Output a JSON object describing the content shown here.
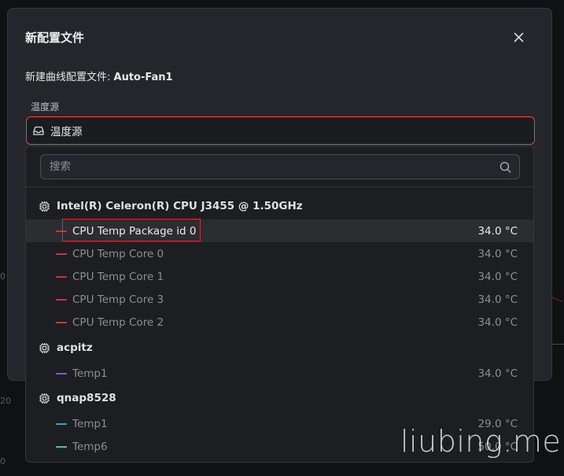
{
  "modal": {
    "title": "新配置文件",
    "subtitle_prefix": "新建曲线配置文件: ",
    "profile_name": "Auto-Fan1",
    "field_label": "温度源",
    "select_value": "温度源"
  },
  "dropdown": {
    "search_placeholder": "搜索",
    "groups": [
      {
        "name": "Intel(R) Celeron(R) CPU J3455 @ 1.50GHz",
        "options": [
          {
            "label": "CPU Temp Package id 0",
            "value": "34.0 °C",
            "color": "#c0363d",
            "active": true
          },
          {
            "label": "CPU Temp Core 0",
            "value": "34.0 °C",
            "color": "#c0363d"
          },
          {
            "label": "CPU Temp Core 1",
            "value": "34.0 °C",
            "color": "#c0363d"
          },
          {
            "label": "CPU Temp Core 3",
            "value": "34.0 °C",
            "color": "#c0363d"
          },
          {
            "label": "CPU Temp Core 2",
            "value": "34.0 °C",
            "color": "#c0363d"
          }
        ]
      },
      {
        "name": "acpitz",
        "options": [
          {
            "label": "Temp1",
            "value": "34.0 °C",
            "color": "#7b5cc4"
          }
        ]
      },
      {
        "name": "qnap8528",
        "options": [
          {
            "label": "Temp1",
            "value": "29.0 °C",
            "color": "#2fa6b3"
          },
          {
            "label": "Temp6",
            "value": "50.0 °C",
            "color": "#3cc79a"
          }
        ]
      }
    ]
  },
  "background": {
    "ticks": [
      "0",
      "20",
      "0"
    ]
  },
  "watermark": "liubing.me",
  "icons": {
    "close": "close-icon",
    "select": "inbox-icon",
    "search": "search-icon",
    "group": "chip-icon"
  },
  "colors": {
    "accent_error": "#e0494f",
    "highlight": "#d2323a"
  }
}
